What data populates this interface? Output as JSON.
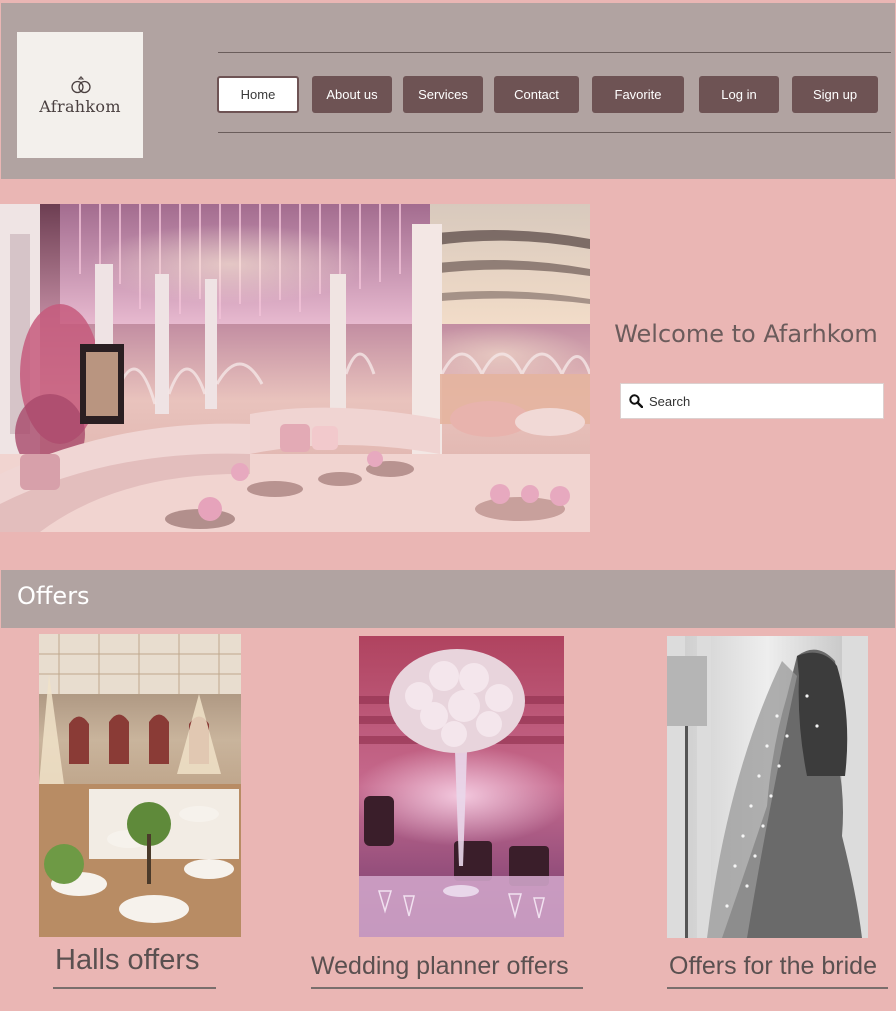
{
  "brand": {
    "logo_text": "Afrahkom"
  },
  "nav": {
    "items": [
      {
        "label": "Home",
        "active": true
      },
      {
        "label": "About us"
      },
      {
        "label": "Services"
      },
      {
        "label": "Contact"
      },
      {
        "label": "Favorite"
      },
      {
        "label": "Log in"
      },
      {
        "label": "Sign up"
      }
    ]
  },
  "hero": {
    "welcome": "Welcome to Afarhkom",
    "search_placeholder": "Search"
  },
  "offers": {
    "title": "Offers",
    "items": [
      {
        "label": "Halls offers"
      },
      {
        "label": "Wedding planner offers"
      },
      {
        "label": "Offers for the bride"
      }
    ]
  },
  "colors": {
    "page_bg": "#eab6b4",
    "header_bg": "#b1a3a1",
    "nav_button": "#6e5354",
    "text_muted": "#6b5b5b"
  }
}
